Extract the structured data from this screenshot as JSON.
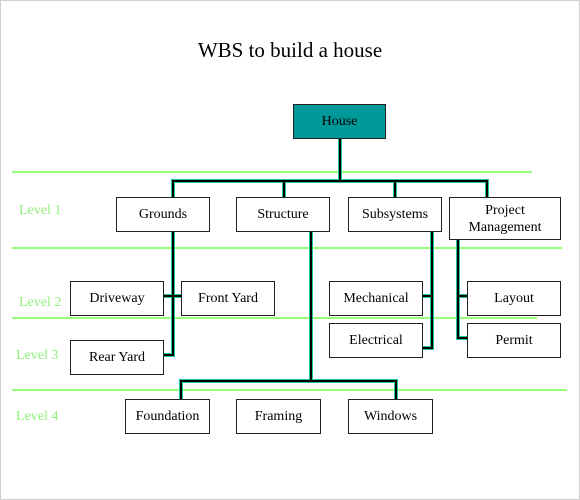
{
  "title": "WBS to build a house",
  "colors": {
    "root_fill": "#00999a",
    "connector_outer": "#1dc99c",
    "connector_inner": "#000000",
    "level_text": "#8ef07a",
    "level_lines": "#99ff77"
  },
  "levels": [
    "Level 1",
    "Level 2",
    "Level 3",
    "Level 4"
  ],
  "nodes": {
    "root": "House",
    "grounds": "Grounds",
    "structure": "Structure",
    "subsystems": "Subsystems",
    "pm": "Project Management",
    "driveway": "Driveway",
    "frontyard": "Front Yard",
    "rearyard": "Rear Yard",
    "mechanical": "Mechanical",
    "electrical": "Electrical",
    "layout": "Layout",
    "permit": "Permit",
    "foundation": "Foundation",
    "framing": "Framing",
    "windows": "Windows"
  }
}
